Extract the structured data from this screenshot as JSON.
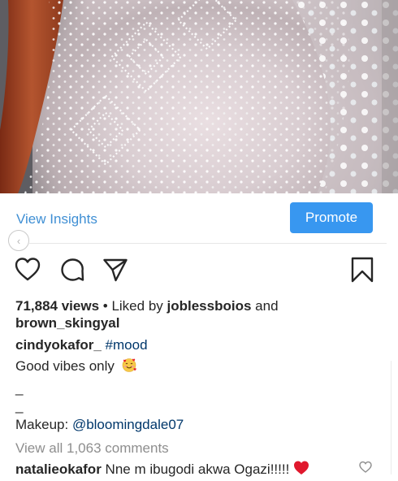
{
  "post": {
    "media": {
      "subject": "photo",
      "palette": [
        "#eadfe2",
        "#bfb2b6",
        "#a34a2c",
        "#ffffff"
      ]
    },
    "insights_label": "View Insights",
    "promote_label": "Promote",
    "back_icon": "chevron-left-icon",
    "actions": {
      "like_icon": "heart-outline-icon",
      "comment_icon": "comment-bubble-icon",
      "share_icon": "paper-plane-icon",
      "save_icon": "bookmark-outline-icon"
    },
    "stats": {
      "views": "71,884 views",
      "liked_by_prefix": "Liked by",
      "liked_user_1": "joblessboios",
      "and_text": "and",
      "liked_user_2": "brown_skingyal"
    },
    "caption": {
      "username": "cindyokafor_",
      "hashtag": "#mood",
      "line_1": "Good vibes only",
      "line_1_emoji": "smiling-face-with-hearts-emoji",
      "line_2": "_",
      "line_3": "_",
      "makeup_label": "Makeup:",
      "makeup_handle": "@bloomingdale07"
    },
    "view_comments": "View all 1,063 comments",
    "comment": {
      "username": "natalieokafor",
      "text": "Nne m ibugodi akwa Ogazi!!!!!",
      "emoji": "red-heart-emoji",
      "like_icon": "heart-outline-icon"
    },
    "colors": {
      "link_blue": "#3f8fd4",
      "button_blue": "#3897f0",
      "text": "#262626",
      "muted": "#8e8e8e",
      "mention": "#00376b"
    }
  }
}
